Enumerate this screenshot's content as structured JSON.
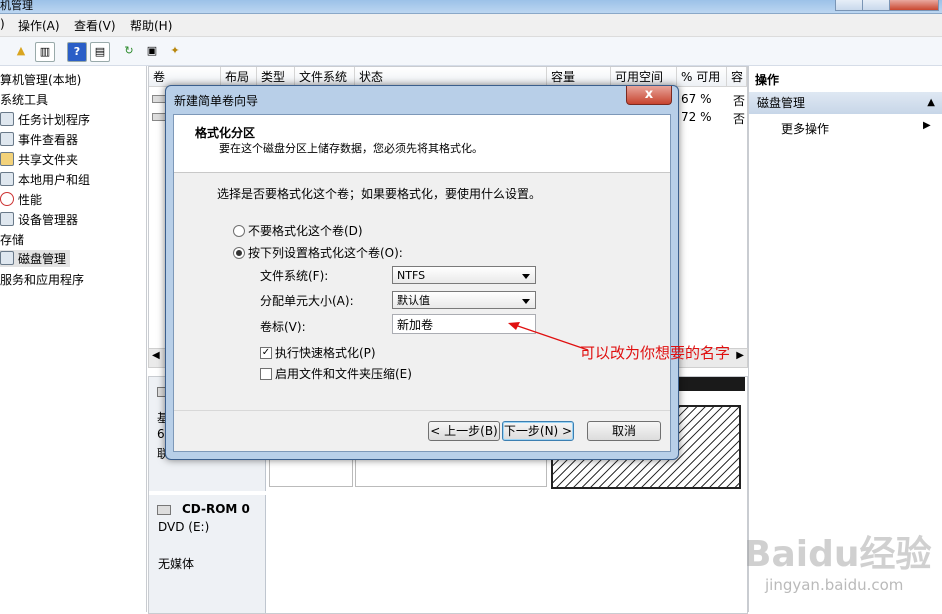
{
  "window": {
    "title": "机管理"
  },
  "menu": {
    "action": "操作(A)",
    "view": "查看(V)",
    "help": "帮助(H)"
  },
  "tree": {
    "root": "算机管理(本地)",
    "system_tools": "系统工具",
    "items": [
      "任务计划程序",
      "事件查看器",
      "共享文件夹",
      "本地用户和组",
      "性能",
      "设备管理器"
    ],
    "storage": "存储",
    "disk_mgmt": "磁盘管理",
    "services": "服务和应用程序"
  },
  "table": {
    "columns": [
      "卷",
      "布局",
      "类型",
      "文件系统",
      "状态",
      "容量",
      "可用空间",
      "% 可用",
      "容"
    ],
    "rows": [
      {
        "pct": "67 %",
        "fault": "否"
      },
      {
        "pct": "72 %",
        "fault": "否"
      }
    ]
  },
  "diskmap": {
    "disk0": {
      "l1": "基",
      "l2": "6",
      "l3": "联"
    },
    "cdrom": {
      "name": "CD-ROM 0",
      "drive": "DVD (E:)",
      "media": "无媒体"
    }
  },
  "actions": {
    "header": "操作",
    "section": "磁盘管理",
    "more": "更多操作"
  },
  "dialog": {
    "title": "新建简单卷向导",
    "close": "x",
    "heading": "格式化分区",
    "subheading": "要在这个磁盘分区上储存数据，您必须先将其格式化。",
    "prompt": "选择是否要格式化这个卷；如果要格式化，要使用什么设置。",
    "no_format": "不要格式化这个卷(D)",
    "format_with": "按下列设置格式化这个卷(O):",
    "fs_label": "文件系统(F):",
    "fs_value": "NTFS",
    "alloc_label": "分配单元大小(A):",
    "alloc_value": "默认值",
    "vol_label": "卷标(V):",
    "vol_value": "新加卷",
    "quick_format": "执行快速格式化(P)",
    "compress": "启用文件和文件夹压缩(E)",
    "back": "< 上一步(B)",
    "next": "下一步(N) >",
    "cancel": "取消"
  },
  "annotation": "可以改为你想要的名字",
  "watermark": {
    "brand": "Baidu经验",
    "url": "jingyan.baidu.com"
  }
}
